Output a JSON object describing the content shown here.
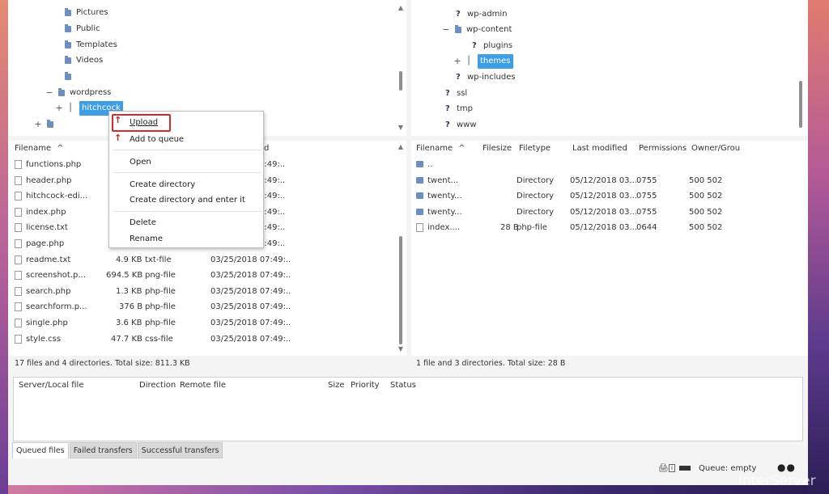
{
  "local_tree": {
    "items": [
      {
        "label": "Pictures",
        "indent": 3,
        "expander": "",
        "selected": false
      },
      {
        "label": "Public",
        "indent": 3,
        "expander": "",
        "selected": false
      },
      {
        "label": "Templates",
        "indent": 3,
        "expander": "",
        "selected": false
      },
      {
        "label": "Videos",
        "indent": 3,
        "expander": "",
        "selected": false
      },
      {
        "label": "",
        "indent": 3,
        "expander": "",
        "selected": false
      },
      {
        "label": "wordpress",
        "indent": 2,
        "expander": "−",
        "selected": false
      },
      {
        "label": "hitchcock",
        "indent": 3,
        "expander": "+",
        "selected": true
      }
    ],
    "bottom_expander": "+"
  },
  "remote_tree": {
    "items": [
      {
        "label": "wp-admin",
        "icon": "question-folder"
      },
      {
        "label": "wp-content",
        "icon": "folder",
        "expander": "−"
      },
      {
        "label": "plugins",
        "icon": "question-folder"
      },
      {
        "label": "themes",
        "icon": "folder",
        "expander": "+",
        "selected": true
      },
      {
        "label": "wp-includes",
        "icon": "question-folder"
      },
      {
        "label": "ssl",
        "icon": "question-folder"
      },
      {
        "label": "tmp",
        "icon": "question-folder"
      },
      {
        "label": "www",
        "icon": "question-folder"
      }
    ]
  },
  "local_list": {
    "headers": {
      "filename": "Filename",
      "sort_arrow": "^",
      "modified_partial": "d"
    },
    "rows": [
      {
        "name": "functions.php",
        "size": "",
        "type": "",
        "modified": "7:49:.."
      },
      {
        "name": "header.php",
        "size": "",
        "type": "",
        "modified": "7:49:.."
      },
      {
        "name": "hitchcock-edi...",
        "size": "",
        "type": "",
        "modified": "7:49:.."
      },
      {
        "name": "index.php",
        "size": "",
        "type": "",
        "modified": "7:49:.."
      },
      {
        "name": "license.txt",
        "size": "",
        "type": "",
        "modified": "7:49:.."
      },
      {
        "name": "page.php",
        "size": "",
        "type": "",
        "modified": "7:49:.."
      },
      {
        "name": "readme.txt",
        "size": "4.9 KB",
        "type": "txt-file",
        "modified": "03/25/2018 07:49:.."
      },
      {
        "name": "screenshot.p...",
        "size": "694.5 KB",
        "type": "png-file",
        "modified": "03/25/2018 07:49:.."
      },
      {
        "name": "search.php",
        "size": "1.3 KB",
        "type": "php-file",
        "modified": "03/25/2018 07:49:.."
      },
      {
        "name": "searchform.p...",
        "size": "376 B",
        "type": "php-file",
        "modified": "03/25/2018 07:49:.."
      },
      {
        "name": "single.php",
        "size": "3.6 KB",
        "type": "php-file",
        "modified": "03/25/2018 07:49:.."
      },
      {
        "name": "style.css",
        "size": "47.7 KB",
        "type": "css-file",
        "modified": "03/25/2018 07:49:.."
      }
    ],
    "status": "17 files and 4 directories. Total size: 811.3 KB"
  },
  "remote_list": {
    "headers": {
      "filename": "Filename",
      "sort_arrow": "^",
      "filesize": "Filesize",
      "filetype": "Filetype",
      "last_modified": "Last modified",
      "permissions": "Permissions",
      "owner": "Owner/Grou"
    },
    "rows": [
      {
        "name": "..",
        "size": "",
        "type": "",
        "modified": "",
        "perms": "",
        "owner": "",
        "kind": "dir"
      },
      {
        "name": "twent...",
        "size": "",
        "type": "Directory",
        "modified": "05/12/2018 03...",
        "perms": "0755",
        "owner": "500 502",
        "kind": "dir"
      },
      {
        "name": "twenty...",
        "size": "",
        "type": "Directory",
        "modified": "05/12/2018 03...",
        "perms": "0755",
        "owner": "500 502",
        "kind": "dir"
      },
      {
        "name": "twenty...",
        "size": "",
        "type": "Directory",
        "modified": "05/12/2018 03...",
        "perms": "0755",
        "owner": "500 502",
        "kind": "dir"
      },
      {
        "name": "index....",
        "size": "28 B",
        "type": "php-file",
        "modified": "05/12/2018 03...",
        "perms": "0644",
        "owner": "500 502",
        "kind": "file"
      }
    ],
    "status": "1 file and 3 directories. Total size: 28 B"
  },
  "context_menu": {
    "upload": "Upload",
    "add_to_queue": "Add to queue",
    "open": "Open",
    "create_directory": "Create directory",
    "create_directory_enter": "Create directory and enter it",
    "delete": "Delete",
    "rename": "Rename"
  },
  "queue": {
    "headers": {
      "server_local": "Server/Local file",
      "direction": "Direction",
      "remote": "Remote file",
      "size": "Size",
      "priority": "Priority",
      "status": "Status"
    },
    "tabs": [
      "Queued files",
      "Failed transfers",
      "Successful transfers"
    ],
    "status": "Queue: empty"
  },
  "watermark": "InterServer",
  "colors": {
    "selection": "#3d9ee6",
    "highlight_box": "#d32a2a"
  }
}
